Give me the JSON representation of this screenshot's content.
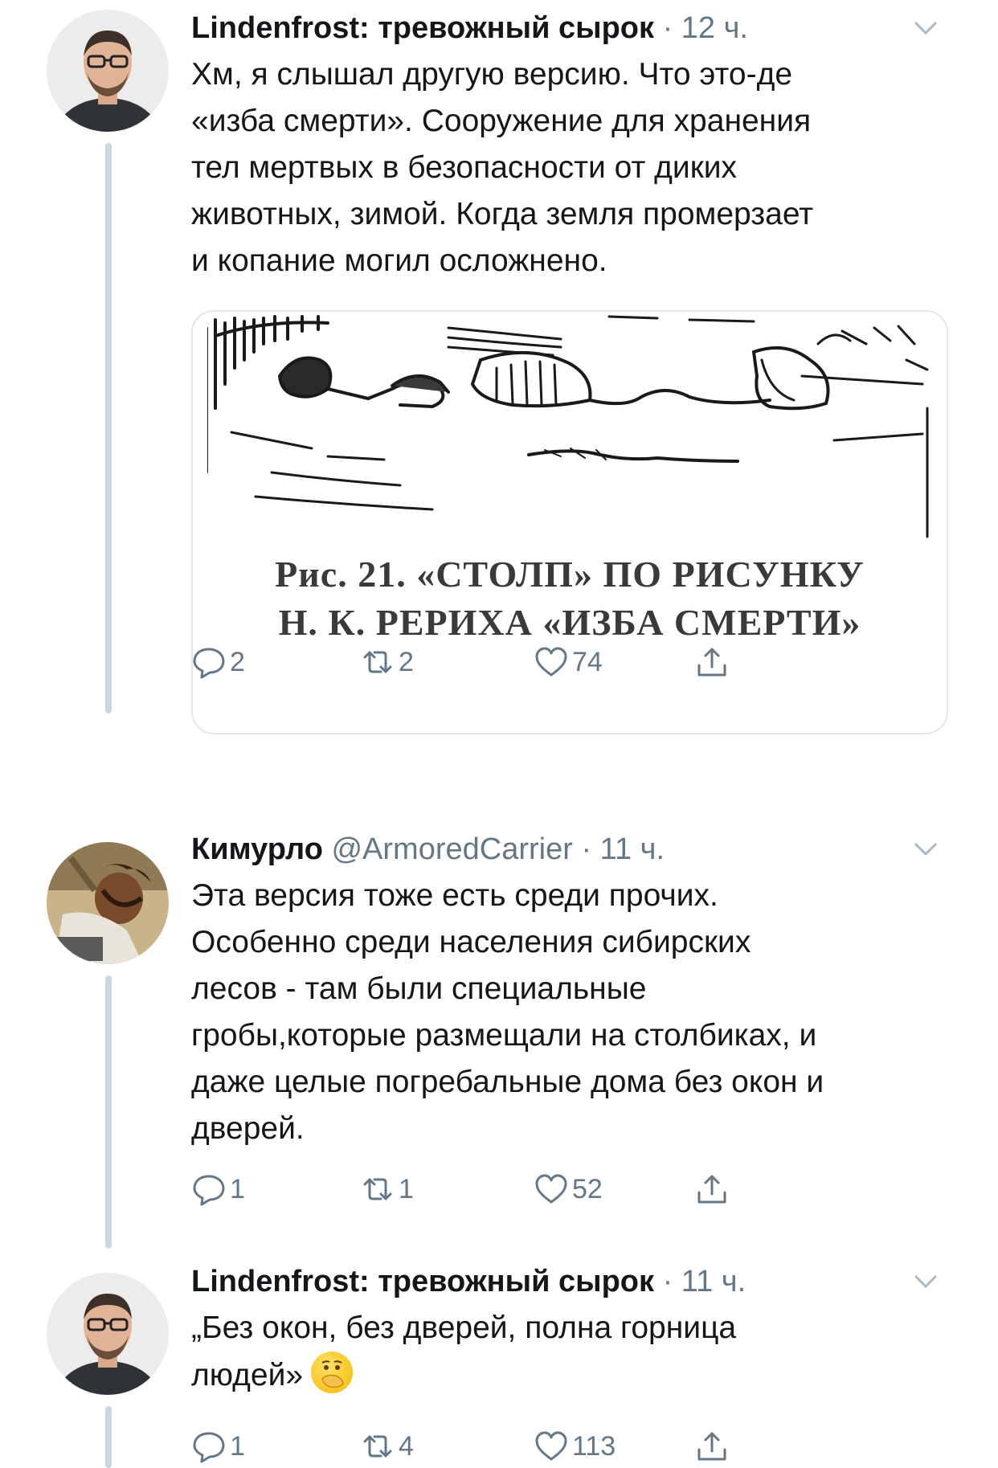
{
  "tweets": [
    {
      "name": "Lindenfrost: тревожный сырок",
      "handle": "",
      "time": "· 12 ч.",
      "text": [
        "Хм, я слышал другую версию. Что это-де",
        "«изба смерти». Сооружение для хранения",
        "тел мертвых в безопасности от диких",
        "животных, зимой. Когда земля промерзает",
        "и копание могил осложнено."
      ],
      "media": {
        "caption": [
          "Рис. 21. «СТОЛП» ПО РИСУНКУ",
          "Н. К. РЕРИХА «ИЗБА СМЕРТИ»"
        ]
      },
      "actions": {
        "replies": "2",
        "retweets": "2",
        "likes": "74"
      }
    },
    {
      "name": "Кимурло",
      "handle": "@ArmoredCarrier",
      "time": "· 11 ч.",
      "text": [
        "Эта версия тоже есть среди прочих.",
        "Особенно среди населения сибирских",
        "лесов - там были специальные",
        "гробы,которые размещали на столбиках, и",
        "даже целые погребальные дома без окон и",
        "дверей."
      ],
      "actions": {
        "replies": "1",
        "retweets": "1",
        "likes": "52"
      }
    },
    {
      "name": "Lindenfrost: тревожный сырок",
      "handle": "",
      "time": "· 11 ч.",
      "text": [
        "„Без окон, без дверей, полна горница",
        "людей»"
      ],
      "emoji": "hand-over-mouth-emoji",
      "actions": {
        "replies": "1",
        "retweets": "4",
        "likes": "113"
      }
    }
  ],
  "colors": {
    "text": "#14171a",
    "secondary": "#657786",
    "border": "#e1e8ed",
    "thread_line": "#ccd6dd"
  }
}
